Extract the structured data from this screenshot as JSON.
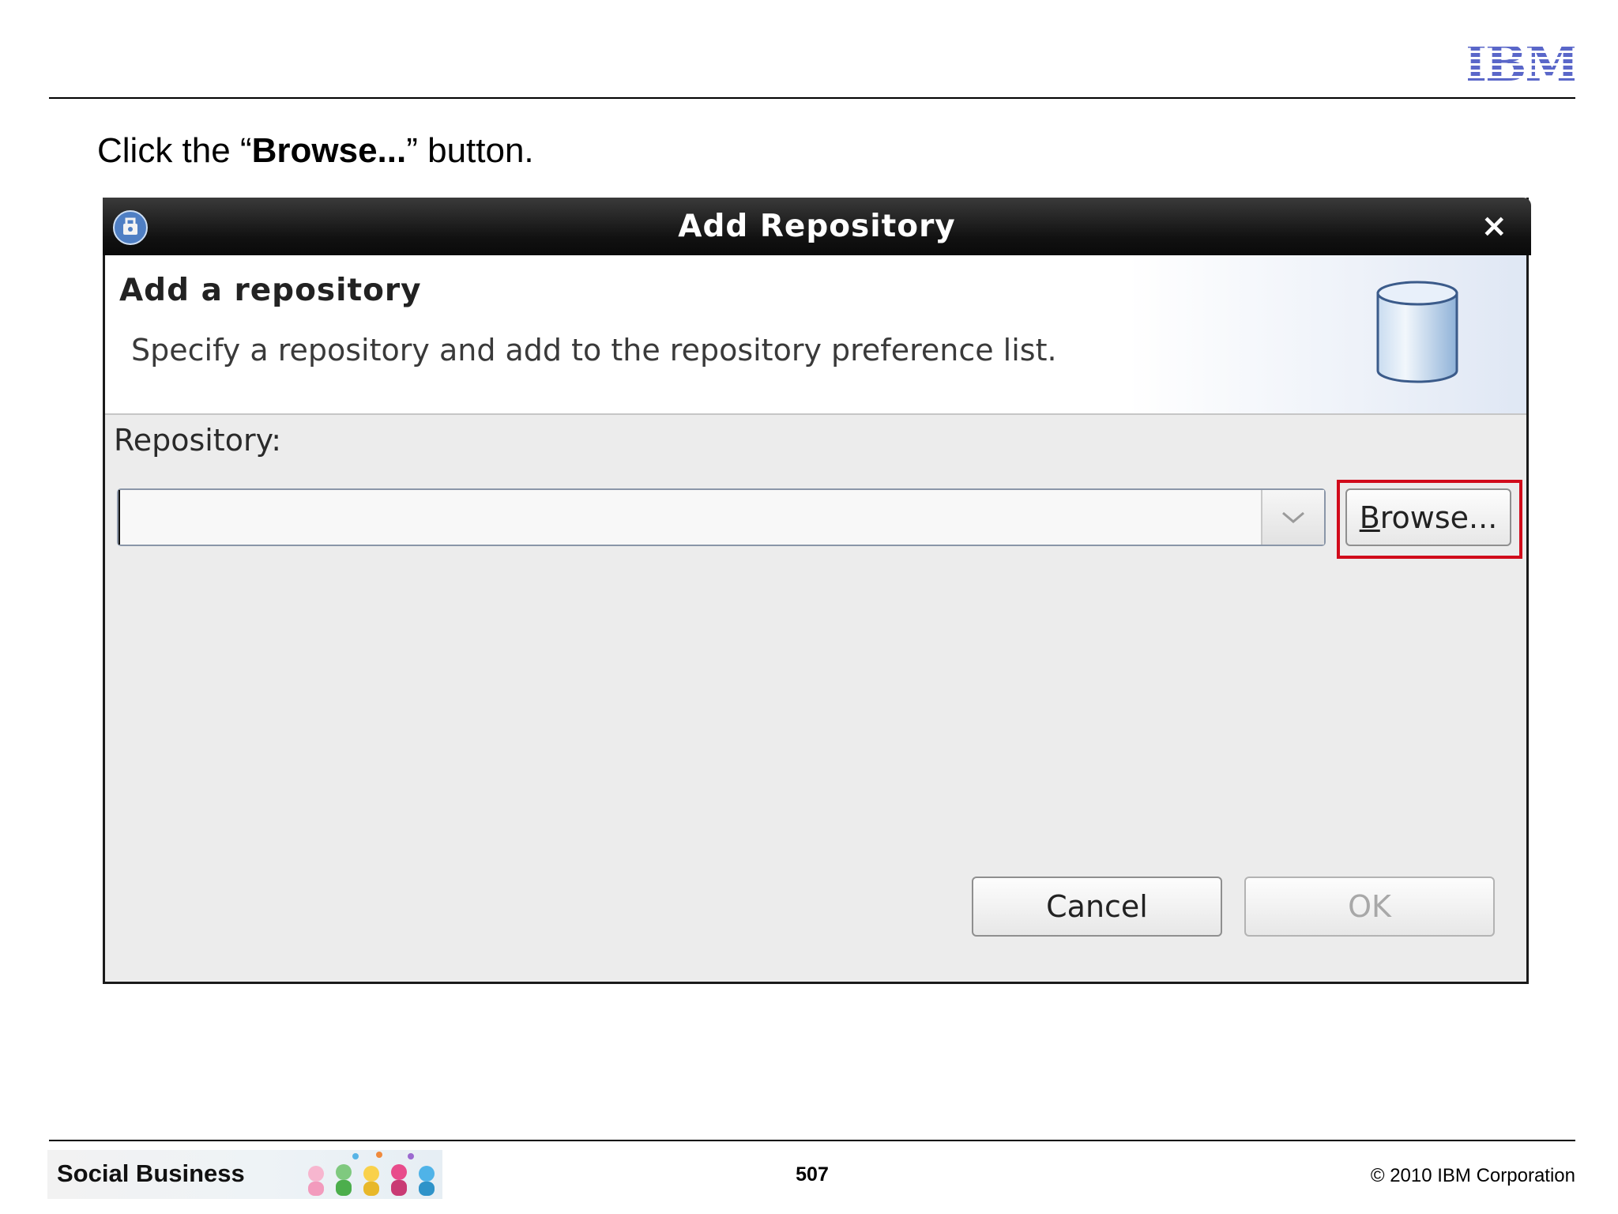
{
  "slide": {
    "instruction_prefix": "Click the “",
    "instruction_bold": "Browse...",
    "instruction_suffix": "” button.",
    "logo_text": "IBM",
    "page_number": "507",
    "copyright": "© 2010 IBM Corporation",
    "footer_brand": "Social Business"
  },
  "dialog": {
    "title": "Add Repository",
    "close_glyph": "×",
    "banner_title": "Add a repository",
    "banner_description": "Specify a repository and add to the repository preference list.",
    "repository_label": "Repository:",
    "repository_value": "",
    "browse_mnemonic": "B",
    "browse_rest": "rowse...",
    "cancel_label": "Cancel",
    "ok_label": "OK",
    "ok_enabled": false
  },
  "colors": {
    "ibm_blue": "#5a67c9",
    "highlight_red": "#d10b1b",
    "titlebar": "#111111"
  },
  "icons": [
    "app-icon",
    "close-icon",
    "database-icon",
    "chevron-down-icon"
  ]
}
